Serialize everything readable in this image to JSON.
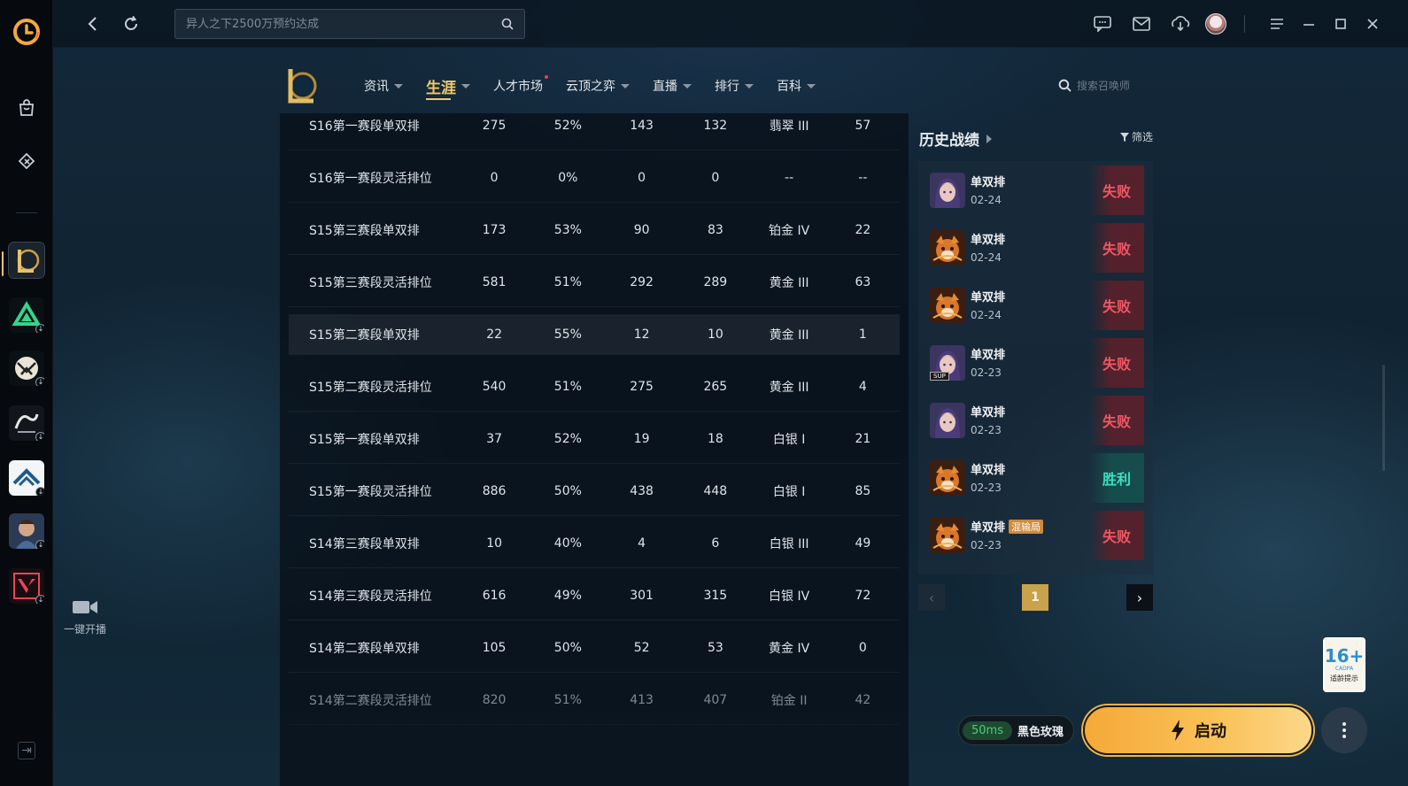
{
  "topbar": {
    "search_placeholder": "异人之下2500万预约达成"
  },
  "lol_nav": {
    "items": [
      {
        "label": "资讯",
        "active": false,
        "caret": true
      },
      {
        "label": "生涯",
        "active": true,
        "caret": true
      },
      {
        "label": "人才市场",
        "active": false,
        "caret": false,
        "dot": true
      },
      {
        "label": "云顶之弈",
        "active": false,
        "caret": true
      },
      {
        "label": "直播",
        "active": false,
        "caret": true
      },
      {
        "label": "排行",
        "active": false,
        "caret": true
      },
      {
        "label": "百科",
        "active": false,
        "caret": true
      }
    ],
    "summoner_search_placeholder": "搜索召唤师"
  },
  "ranked_table": {
    "rows": [
      [
        "S16第一赛段单双排",
        "275",
        "52%",
        "143",
        "132",
        "翡翠 III",
        "57"
      ],
      [
        "S16第一赛段灵活排位",
        "0",
        "0%",
        "0",
        "0",
        "--",
        "--"
      ],
      [
        "S15第三赛段单双排",
        "173",
        "53%",
        "90",
        "83",
        "铂金 IV",
        "22"
      ],
      [
        "S15第三赛段灵活排位",
        "581",
        "51%",
        "292",
        "289",
        "黄金 III",
        "63"
      ],
      [
        "S15第二赛段单双排",
        "22",
        "55%",
        "12",
        "10",
        "黄金 III",
        "1"
      ],
      [
        "S15第二赛段灵活排位",
        "540",
        "51%",
        "275",
        "265",
        "黄金 III",
        "4"
      ],
      [
        "S15第一赛段单双排",
        "37",
        "52%",
        "19",
        "18",
        "白银 I",
        "21"
      ],
      [
        "S15第一赛段灵活排位",
        "886",
        "50%",
        "438",
        "448",
        "白银 I",
        "85"
      ],
      [
        "S14第三赛段单双排",
        "10",
        "40%",
        "4",
        "6",
        "白银 III",
        "49"
      ],
      [
        "S14第三赛段灵活排位",
        "616",
        "49%",
        "301",
        "315",
        "白银 IV",
        "72"
      ],
      [
        "S14第二赛段单双排",
        "105",
        "50%",
        "52",
        "53",
        "黄金 IV",
        "0"
      ],
      [
        "S14第二赛段灵活排位",
        "820",
        "51%",
        "413",
        "407",
        "铂金 II",
        "42"
      ]
    ]
  },
  "history": {
    "title": "历史战绩",
    "filter_label": "筛选",
    "matches": [
      {
        "mode": "单双排",
        "date": "02-24",
        "result": "失败",
        "win": false,
        "champ": "ahri"
      },
      {
        "mode": "单双排",
        "date": "02-24",
        "result": "失败",
        "win": false,
        "champ": "fox"
      },
      {
        "mode": "单双排",
        "date": "02-24",
        "result": "失败",
        "win": false,
        "champ": "fox"
      },
      {
        "mode": "单双排",
        "date": "02-23",
        "result": "失败",
        "win": false,
        "champ": "ahri",
        "tag": "SUP"
      },
      {
        "mode": "单双排",
        "date": "02-23",
        "result": "失败",
        "win": false,
        "champ": "ahri"
      },
      {
        "mode": "单双排",
        "date": "02-23",
        "result": "胜利",
        "win": true,
        "champ": "fox"
      },
      {
        "mode": "单双排",
        "date": "02-23",
        "result": "失败",
        "win": false,
        "champ": "fox",
        "badge": "混输局"
      }
    ],
    "page": "1"
  },
  "live": {
    "label": "一键开播"
  },
  "launcher": {
    "ping": "50ms",
    "server": "黑色玫瑰",
    "launch_label": "启动"
  },
  "age_rating": {
    "age": "16+",
    "sub": "CADPA",
    "hint": "适龄提示"
  },
  "colors": {
    "accent_gold": "#f1c96a",
    "loss_red": "#ee5864",
    "win_teal": "#3ee0c0",
    "launch_orange": "#f6a938"
  }
}
